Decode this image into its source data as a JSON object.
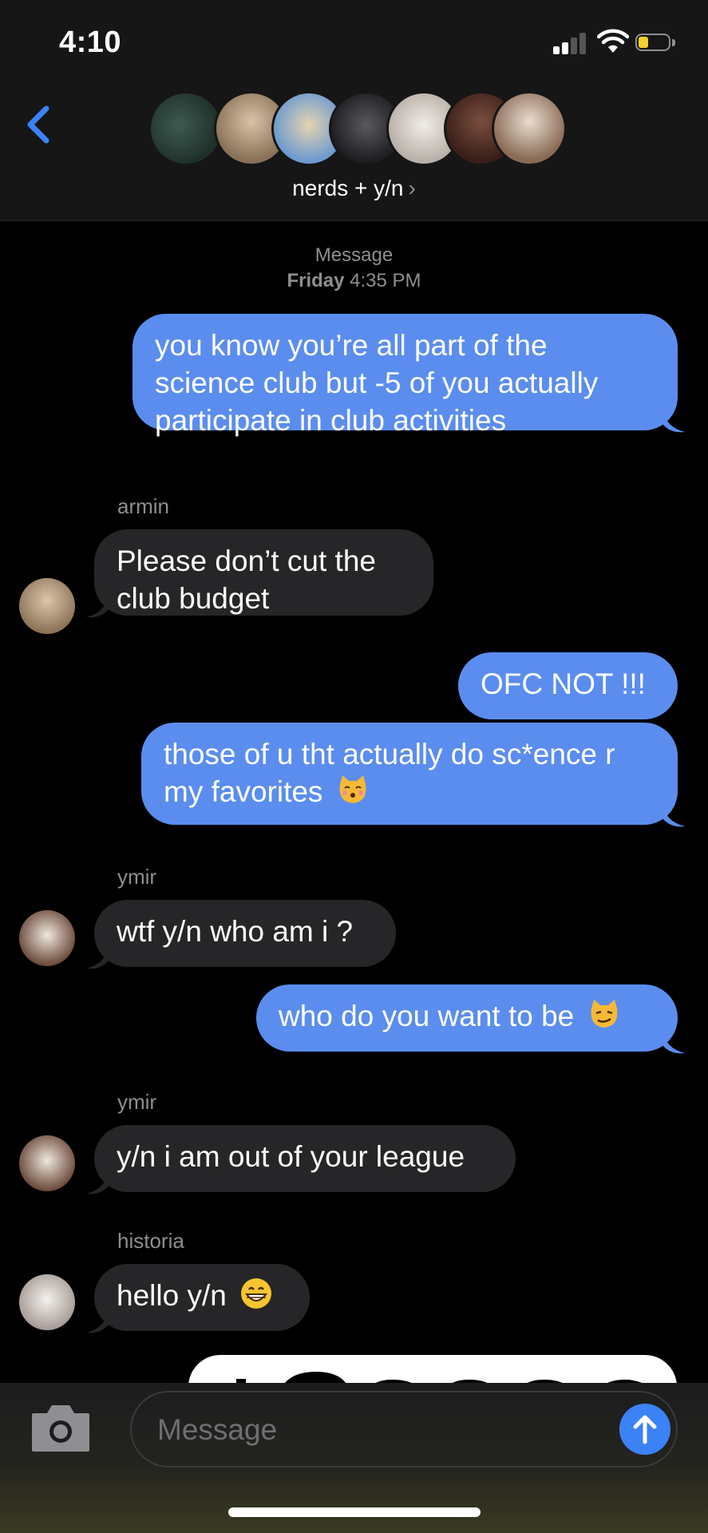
{
  "status": {
    "time": "4:10"
  },
  "header": {
    "group_name": "nerds + y/n",
    "chevron": "›"
  },
  "thread": {
    "meta_label": "Message",
    "meta_day": "Friday",
    "meta_time": "4:35 PM",
    "messages": [
      {
        "direction": "out",
        "text": "you know you’re all part of the science club but -5 of you actually participate in club activities"
      },
      {
        "direction": "in",
        "sender": "armin",
        "text": "Please don’t cut the club budget"
      },
      {
        "direction": "out",
        "text": "OFC NOT !!!"
      },
      {
        "direction": "out",
        "text": "those of u tht actually do sc*ence r my favorites",
        "emoji": "kissing-cat-emoji"
      },
      {
        "direction": "in",
        "sender": "ymir",
        "text": "wtf y/n who am i ?"
      },
      {
        "direction": "out",
        "text": "who do you want to be",
        "emoji": "smirk-cat-emoji"
      },
      {
        "direction": "in",
        "sender": "ymir",
        "text": "y/n i am out of your league"
      },
      {
        "direction": "in",
        "sender": "historia",
        "text": "hello y/n",
        "emoji": "grin-emoji"
      }
    ]
  },
  "input": {
    "placeholder": "Message"
  },
  "colors": {
    "outgoing": "#5b8def",
    "incoming": "#262628",
    "accent": "#3b82f6",
    "background": "#000000"
  },
  "icons": [
    "back-chevron-icon",
    "cellular-signal-icon",
    "wifi-icon",
    "battery-icon",
    "camera-icon",
    "send-arrow-icon"
  ]
}
